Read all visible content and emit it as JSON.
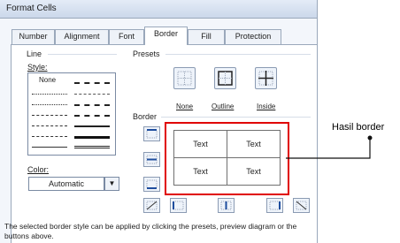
{
  "window": {
    "title": "Format Cells"
  },
  "tabs": [
    {
      "label": "Number",
      "active": false
    },
    {
      "label": "Alignment",
      "active": false
    },
    {
      "label": "Font",
      "active": false
    },
    {
      "label": "Border",
      "active": true
    },
    {
      "label": "Fill",
      "active": false
    },
    {
      "label": "Protection",
      "active": false
    }
  ],
  "line_group": {
    "label": "Line",
    "style_label": "Style:",
    "style_none_label": "None",
    "color_label": "Color:",
    "color_value": "Automatic",
    "color_dropdown_icon": "triangle-down"
  },
  "presets": {
    "label": "Presets",
    "items": [
      {
        "label": "None",
        "icon": "preset-none-icon"
      },
      {
        "label": "Outline",
        "icon": "preset-outline-icon"
      },
      {
        "label": "Inside",
        "icon": "preset-inside-icon"
      }
    ]
  },
  "border_group": {
    "label": "Border",
    "cells": [
      "Text",
      "Text",
      "Text",
      "Text"
    ]
  },
  "annotation": {
    "text": "Hasil border",
    "accent_color": "#e00000"
  },
  "footer": {
    "text": "The selected border style can be applied by clicking the presets, preview diagram or the buttons above."
  }
}
